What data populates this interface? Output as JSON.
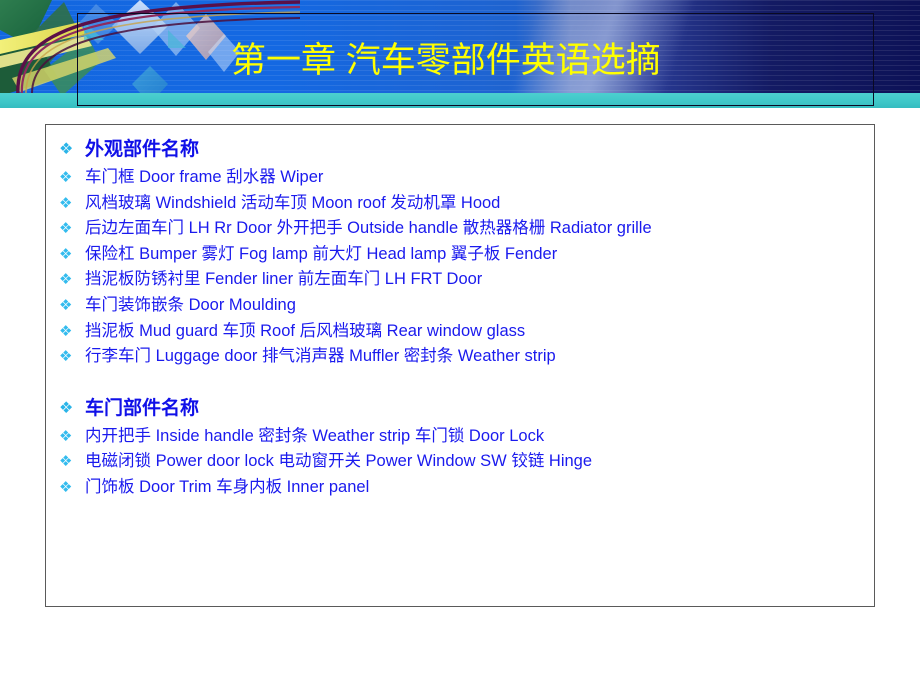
{
  "slide": {
    "title": "第一章 汽车零部件英语选摘",
    "title_color": "#ffff00",
    "banner_colors": {
      "bright_blue": "#1367e0",
      "dark_navy": "#0d1257",
      "teal_strip": "#3ec7c8"
    },
    "body_text_color": "#1a1aee",
    "heading_text_color": "#1010e8",
    "bullet_color": "#33bbee",
    "bullet_icon": "diamond-cluster-bullet"
  },
  "content": {
    "sections": [
      {
        "heading": "外观部件名称",
        "items": [
          "车门框 Door frame    刮水器 Wiper",
          "风档玻璃 Windshield     活动车顶 Moon roof     发动机罩 Hood",
          "后边左面车门 LH Rr Door     外开把手 Outside handle     散热器格栅 Radiator grille",
          "保险杠 Bumper     雾灯 Fog lamp      前大灯 Head lamp     翼子板 Fender",
          "挡泥板防锈衬里 Fender liner      前左面车门 LH FRT Door",
          "车门装饰嵌条 Door Moulding",
          "挡泥板 Mud guard     车顶 Roof      后风档玻璃 Rear window glass",
          "行李车门 Luggage door 排气消声器 Muffler    密封条 Weather strip"
        ]
      },
      {
        "heading": "车门部件名称",
        "items": [
          "内开把手  Inside handle    密封条  Weather strip    车门锁 Door Lock",
          "电磁闭锁 Power door lock   电动窗开关 Power Window SW    铰链 Hinge",
          "门饰板 Door Trim     车身内板 Inner panel"
        ]
      }
    ]
  }
}
